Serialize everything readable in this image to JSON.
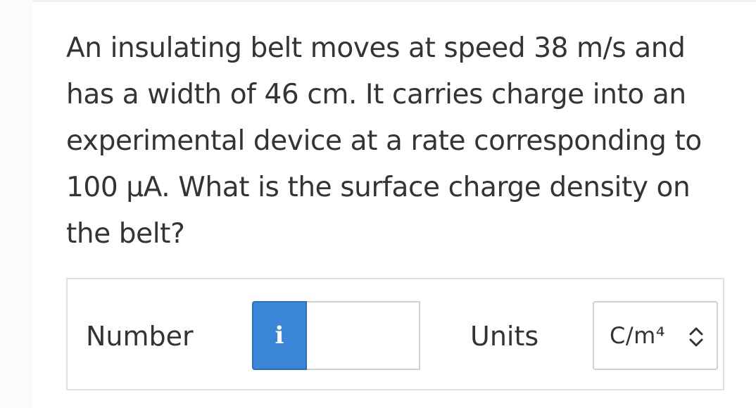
{
  "question": {
    "text": "An insulating belt moves at speed 38 m/s and has a width of 46 cm. It carries charge into an experimental device at a rate corresponding to 100 μA. What is the surface charge density on the belt?"
  },
  "answer": {
    "number_label": "Number",
    "info_icon_glyph": "i",
    "number_value": "",
    "units_label": "Units",
    "units_selected": "C/m⁴"
  },
  "icons": {
    "info": "info-icon",
    "select_arrows": "up-down-chevron-icon"
  },
  "colors": {
    "info_button": "#3a86d6",
    "text": "#333333"
  }
}
